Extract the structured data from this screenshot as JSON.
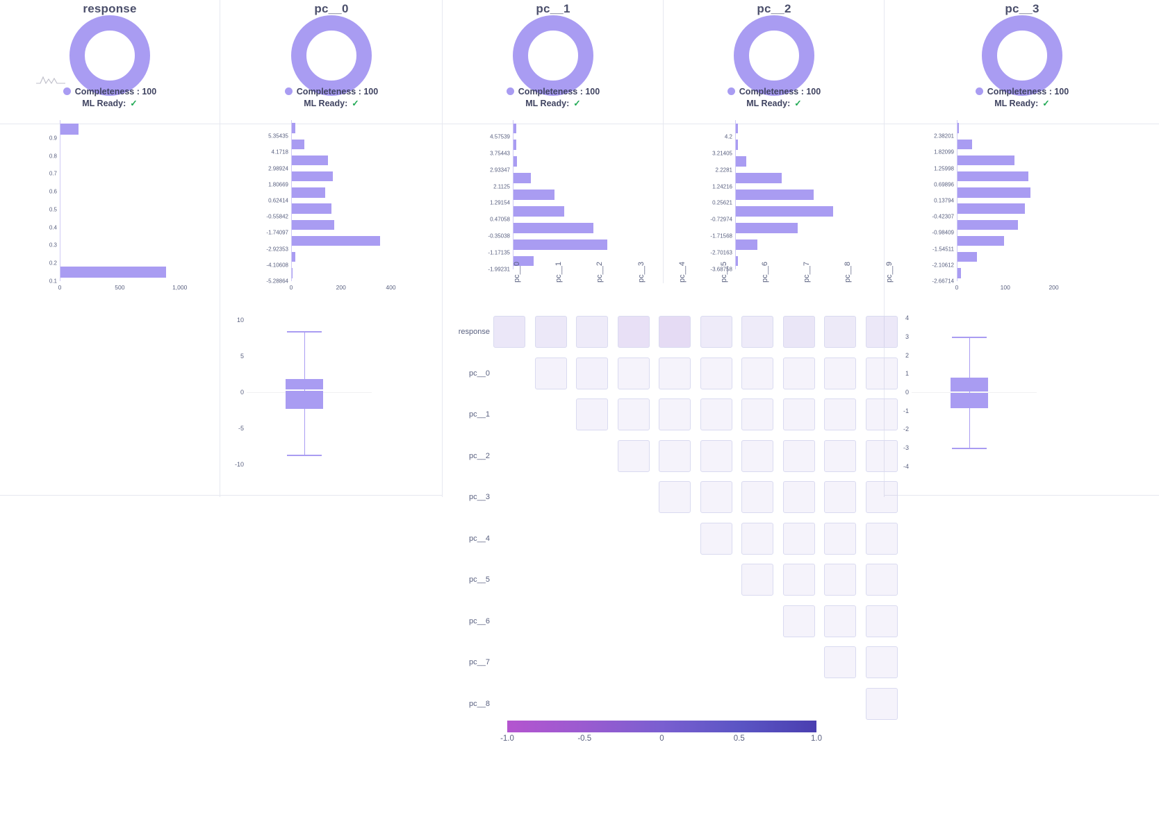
{
  "columns": [
    {
      "name": "response",
      "completeness_label": "Completeness : 100",
      "ml_ready_label": "ML Ready:",
      "check": "✓"
    },
    {
      "name": "pc__0",
      "completeness_label": "Completeness : 100",
      "ml_ready_label": "ML Ready:",
      "check": "✓"
    },
    {
      "name": "pc__1",
      "completeness_label": "Completeness : 100",
      "ml_ready_label": "ML Ready:",
      "check": "✓"
    },
    {
      "name": "pc__2",
      "completeness_label": "Completeness : 100",
      "ml_ready_label": "ML Ready:",
      "check": "✓"
    },
    {
      "name": "pc__3",
      "completeness_label": "Completeness : 100",
      "ml_ready_label": "ML Ready:",
      "check": "✓"
    }
  ],
  "colors": {
    "bar": "#a99cf2",
    "donut": "#a99cf2",
    "check": "#22aa55",
    "title": "#4b4f6b",
    "grid": "#e6e8f0",
    "cm_border": "#d9daf0",
    "cb_low": "#b455cf",
    "cb_high": "#4a3fb0"
  },
  "chart_data": [
    {
      "id": "hist-response",
      "type": "bar",
      "title": "response",
      "orientation": "horizontal",
      "categories": [
        "0.9",
        "0.8",
        "0.7",
        "0.6",
        "0.5",
        "0.4",
        "0.3",
        "0.2",
        "0.1"
      ],
      "values": [
        150,
        0,
        0,
        0,
        0,
        0,
        0,
        0,
        880
      ],
      "xlabel": "",
      "ylabel": "",
      "xticks": [
        "0",
        "500",
        "1,000"
      ],
      "xlim": [
        0,
        1100
      ],
      "grid": false
    },
    {
      "id": "hist-pc0",
      "type": "bar",
      "title": "pc__0",
      "orientation": "horizontal",
      "categories": [
        "5.35435",
        "4.1718",
        "2.98924",
        "1.80669",
        "0.62414",
        "-0.55842",
        "-1.74097",
        "-2.92353",
        "-4.10608",
        "-5.28864"
      ],
      "values": [
        14,
        50,
        145,
        165,
        135,
        160,
        170,
        355,
        13,
        4
      ],
      "xlabel": "",
      "ylabel": "",
      "xticks": [
        "0",
        "200",
        "400"
      ],
      "xlim": [
        0,
        460
      ],
      "grid": false
    },
    {
      "id": "hist-pc1",
      "type": "bar",
      "title": "pc__1",
      "orientation": "horizontal",
      "categories": [
        "4.57539",
        "3.75443",
        "2.93347",
        "2.1125",
        "1.29154",
        "0.47058",
        "-0.35038",
        "-1.17135",
        "-1.99231"
      ],
      "values": [
        8,
        8,
        9,
        50,
        118,
        146,
        230,
        270,
        58
      ],
      "xlabel": "",
      "ylabel": "",
      "xticks": [],
      "xlim": [
        0,
        300
      ],
      "grid": false
    },
    {
      "id": "hist-pc2",
      "type": "bar",
      "title": "pc__2",
      "orientation": "horizontal",
      "categories": [
        "4.2",
        "3.21405",
        "2.2281",
        "1.24216",
        "0.25621",
        "-0.72974",
        "-1.71568",
        "-2.70163",
        "-3.68758"
      ],
      "values": [
        4,
        4,
        22,
        95,
        160,
        200,
        128,
        45,
        4
      ],
      "xlabel": "",
      "ylabel": "",
      "xticks": [],
      "xlim": [
        0,
        215
      ],
      "grid": false
    },
    {
      "id": "hist-pc3",
      "type": "bar",
      "title": "pc__3",
      "orientation": "horizontal",
      "categories": [
        "2.38201",
        "1.82099",
        "1.25998",
        "0.69896",
        "0.13794",
        "-0.42307",
        "-0.98409",
        "-1.54511",
        "-2.10612",
        "-2.66714"
      ],
      "values": [
        3,
        30,
        118,
        146,
        150,
        139,
        124,
        96,
        40,
        7
      ],
      "xlabel": "",
      "ylabel": "",
      "xticks": [
        "0",
        "100",
        "200"
      ],
      "xlim": [
        0,
        215
      ],
      "grid": false
    },
    {
      "id": "box-pc0",
      "type": "box",
      "title": "pc__0",
      "yticks": [
        "10",
        "5",
        "0",
        "-5",
        "-10"
      ],
      "ylim": [
        -11.5,
        11.5
      ],
      "whisker_low": -8.6,
      "q1": -2.3,
      "median": 0.35,
      "q3": 1.85,
      "whisker_high": 8.4,
      "grid": false
    },
    {
      "id": "box-pc3",
      "type": "box",
      "title": "pc__3",
      "yticks": [
        "4",
        "3",
        "2",
        "1",
        "0",
        "-1",
        "-2",
        "-3",
        "-4"
      ],
      "ylim": [
        -4.5,
        4.5
      ],
      "whisker_low": -3.0,
      "q1": -0.85,
      "median": 0.03,
      "q3": 0.78,
      "whisker_high": 3.0,
      "grid": false
    },
    {
      "id": "correlation-matrix",
      "type": "heatmap",
      "title": "",
      "rows": [
        "response",
        "pc__0",
        "pc__1",
        "pc__2",
        "pc__3",
        "pc__4",
        "pc__5",
        "pc__6",
        "pc__7",
        "pc__8"
      ],
      "cols": [
        "pc__0",
        "pc__1",
        "pc__2",
        "pc__3",
        "pc__4",
        "pc__5",
        "pc__6",
        "pc__7",
        "pc__8",
        "pc__9"
      ],
      "values": [
        [
          0.14,
          0.12,
          0.1,
          -0.22,
          -0.28,
          0.09,
          0.1,
          0.15,
          0.11,
          0.12
        ],
        [
          null,
          0.02,
          0.03,
          0.01,
          0.01,
          0.01,
          0.01,
          0.01,
          0.01,
          0.01
        ],
        [
          null,
          null,
          0.02,
          0.01,
          0.01,
          0.01,
          0.01,
          0.01,
          0.01,
          0.01
        ],
        [
          null,
          null,
          null,
          0.01,
          0.01,
          0.01,
          0.01,
          0.01,
          0.01,
          0.01
        ],
        [
          null,
          null,
          null,
          null,
          0.01,
          0.01,
          0.01,
          0.01,
          0.01,
          0.01
        ],
        [
          null,
          null,
          null,
          null,
          null,
          0.01,
          0.01,
          0.01,
          0.01,
          0.01
        ],
        [
          null,
          null,
          null,
          null,
          null,
          null,
          0.01,
          0.01,
          0.01,
          0.01
        ],
        [
          null,
          null,
          null,
          null,
          null,
          null,
          null,
          0.01,
          0.01,
          0.01
        ],
        [
          null,
          null,
          null,
          null,
          null,
          null,
          null,
          null,
          0.01,
          0.01
        ],
        [
          null,
          null,
          null,
          null,
          null,
          null,
          null,
          null,
          null,
          0.01
        ]
      ],
      "colorbar": {
        "ticks": [
          "-1.0",
          "-0.5",
          "0",
          "0.5",
          "1.0"
        ],
        "range": [
          -1,
          1
        ]
      }
    }
  ]
}
